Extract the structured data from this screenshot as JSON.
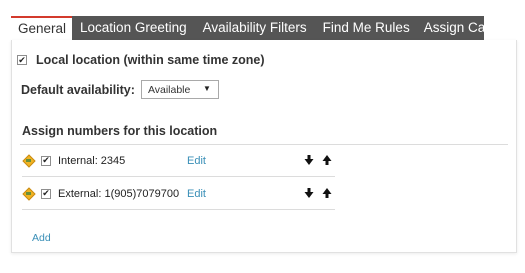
{
  "tabs": [
    {
      "label": "General",
      "active": true
    },
    {
      "label": "Location Greeting",
      "active": false
    },
    {
      "label": "Availability Filters",
      "active": false
    },
    {
      "label": "Find Me Rules",
      "active": false
    },
    {
      "label": "Assign Calls",
      "active": false
    }
  ],
  "general": {
    "local_location": {
      "label": "Local location (within same time zone)",
      "checked": true
    },
    "default_availability": {
      "label": "Default availability:",
      "value": "Available"
    },
    "assign_section_title": "Assign numbers for this location",
    "numbers": [
      {
        "label": "Internal: 2345",
        "checked": true,
        "edit_label": "Edit"
      },
      {
        "label": "External: 1(905)7079700",
        "checked": true,
        "edit_label": "Edit"
      }
    ],
    "add_label": "Add"
  },
  "colors": {
    "tab_bar": "#555555",
    "active_tab_accent": "#d33a2c",
    "link": "#3a8fb7",
    "drag_icon": "#f0b323"
  },
  "icons": {
    "drag_handle": "drag-handle-icon",
    "move_down": "arrow-down-icon",
    "move_up": "arrow-up-icon",
    "dropdown": "chevron-down-icon"
  }
}
